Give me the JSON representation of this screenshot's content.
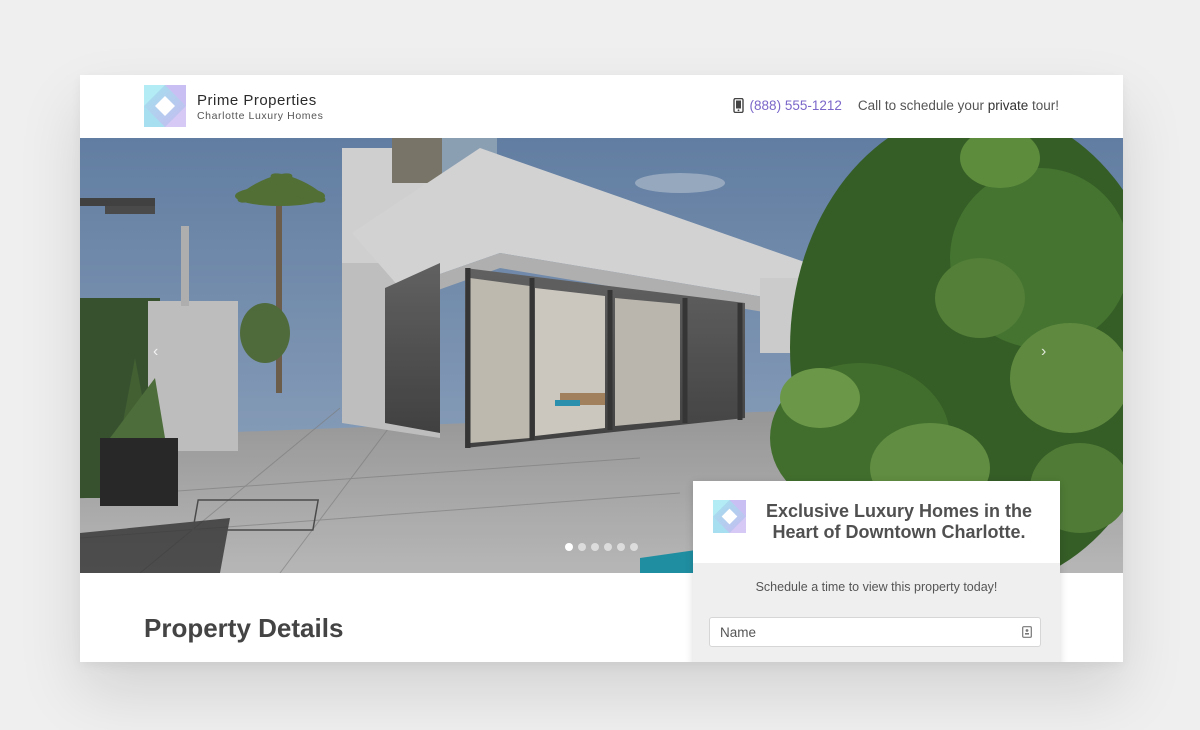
{
  "header": {
    "brand_name": "Prime Properties",
    "brand_tagline": "Charlotte Luxury Homes",
    "phone": "(888) 555-1212",
    "call_text_before": "Call to schedule your ",
    "call_text_bold": "private",
    "call_text_after": " tour!"
  },
  "hero": {
    "slide_count": 6,
    "active_slide": 1
  },
  "main": {
    "section_title": "Property Details"
  },
  "form": {
    "heading": "Exclusive Luxury Homes in the Heart of Downtown Charlotte.",
    "subtitle": "Schedule a time to view this property today!",
    "name_placeholder": "Name"
  },
  "icons": {
    "logo": "logo-icon",
    "phone": "phone-icon",
    "field": "contact-card-icon",
    "prev": "chevron-left-icon",
    "next": "chevron-right-icon"
  },
  "colors": {
    "accent": "#7b67c9",
    "background": "#efefef"
  }
}
